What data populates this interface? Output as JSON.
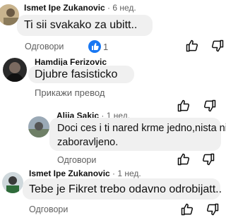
{
  "comments": [
    {
      "author": "Ismet Ipe Zukanovic",
      "age": " · 6 нед.",
      "text": "Ti sii svakako za ubitt..",
      "reply_label": "Одговори",
      "like_count": "1",
      "liked": true
    },
    {
      "author": "Hamdija Ferizovic",
      "age": " · 6 нед.",
      "text": "Djubre fasisticko",
      "translate_label": "Прикажи превод"
    },
    {
      "author": "Alija Sakic",
      "age": " · 1 нед.",
      "text_line1": "Doci ces i ti nared krme jedno,nista nije",
      "text_line2": "zaboravljeno.",
      "reply_label": "Одговори"
    },
    {
      "author": "Ismet Ipe Zukanovic",
      "age": " · 1 нед.",
      "text": "Tebe je Fikret trebo odavno odrobijatt..",
      "reply_label": "Одговори"
    }
  ],
  "colors": {
    "accent": "#1877f2",
    "muted": "#606060",
    "bubble": "#f0f0f0"
  },
  "icons": [
    "like-icon",
    "dislike-icon",
    "liked-reaction-icon"
  ]
}
